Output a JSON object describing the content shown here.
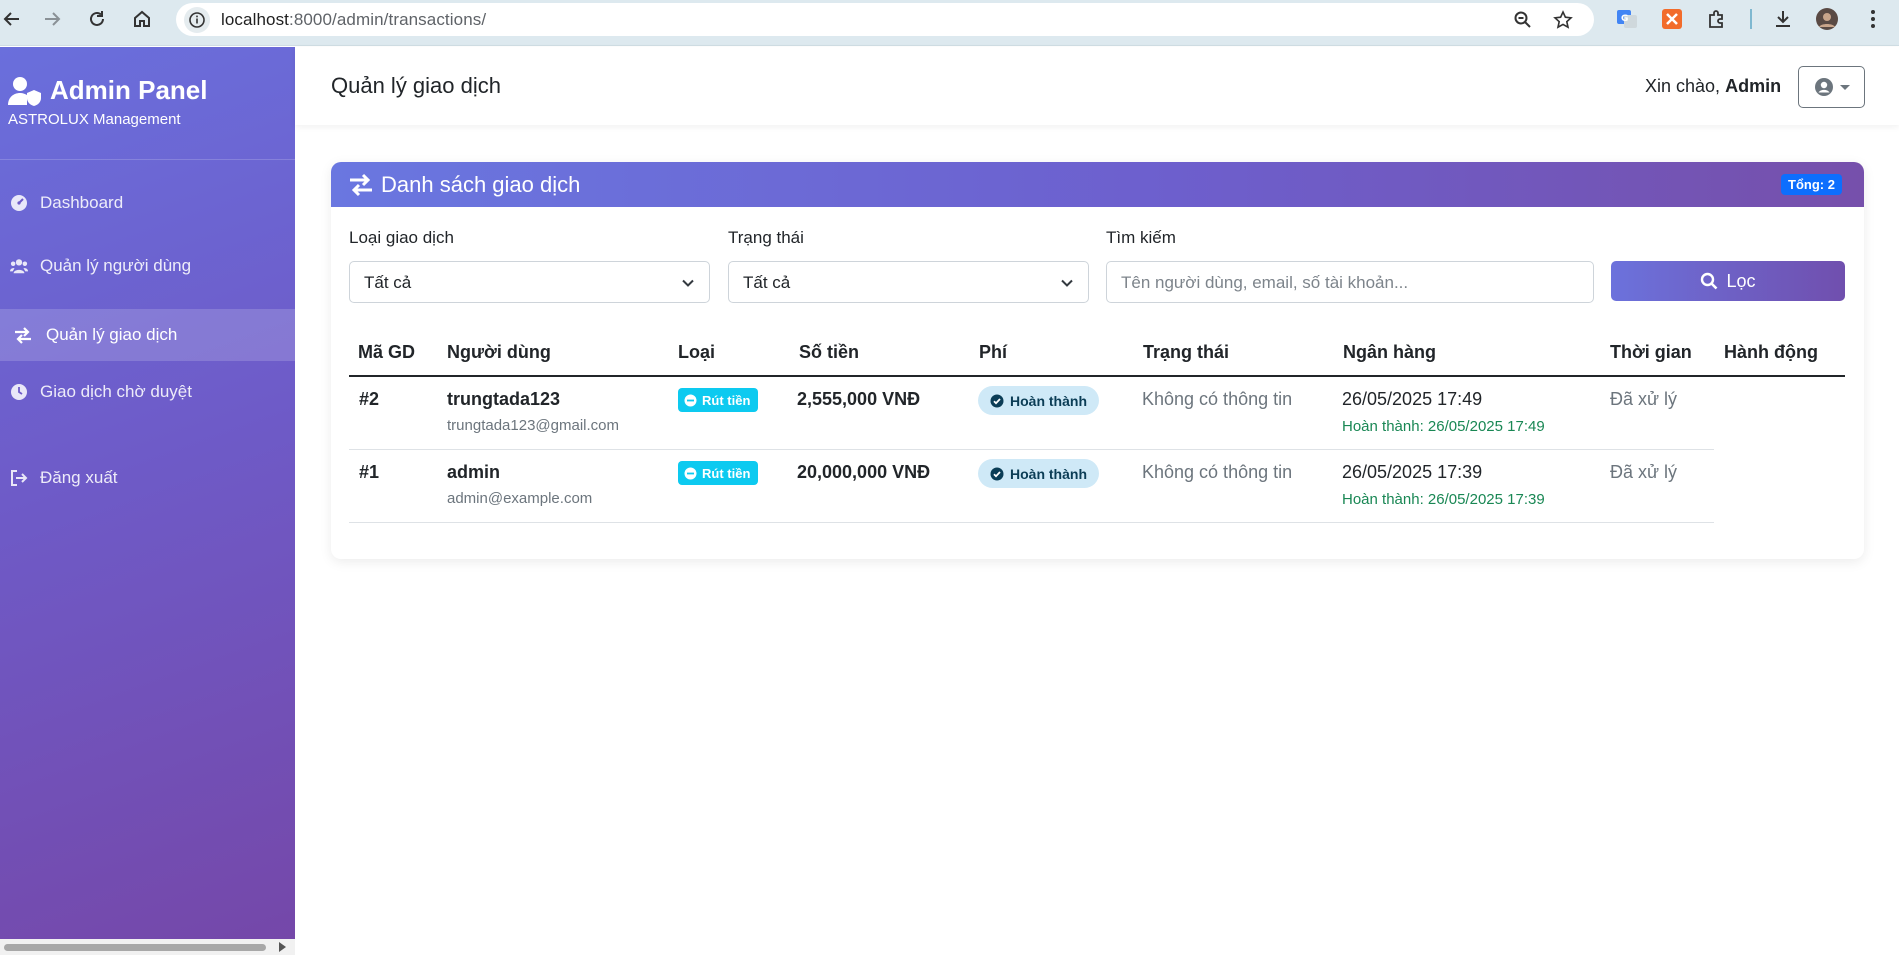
{
  "browser": {
    "url_host": "localhost",
    "url_rest": ":8000/admin/transactions/"
  },
  "sidebar": {
    "brand_title": "Admin Panel",
    "brand_subtitle": "ASTROLUX Management",
    "items": [
      {
        "label": "Dashboard",
        "icon": "tachometer-icon"
      },
      {
        "label": "Quản lý người dùng",
        "icon": "users-icon"
      },
      {
        "label": "Quản lý giao dịch",
        "icon": "exchange-icon",
        "active": true
      },
      {
        "label": "Giao dịch chờ duyệt",
        "icon": "clock-icon"
      },
      {
        "label": "Đăng xuất",
        "icon": "logout-icon"
      }
    ]
  },
  "header": {
    "title": "Quản lý giao dịch",
    "greeting": "Xin chào,",
    "username": "Admin"
  },
  "card": {
    "title": "Danh sách giao dịch",
    "total_badge": "Tổng: 2"
  },
  "filters": {
    "type_label": "Loại giao dịch",
    "type_value": "Tất cả",
    "status_label": "Trạng thái",
    "status_value": "Tất cả",
    "search_label": "Tìm kiếm",
    "search_placeholder": "Tên người dùng, email, số tài khoản...",
    "filter_button": "Lọc"
  },
  "table": {
    "columns": [
      "Mã GD",
      "Người dùng",
      "Loại",
      "Số tiền",
      "Phí",
      "Trạng thái",
      "Ngân hàng",
      "Thời gian",
      "Hành động"
    ],
    "rows": [
      {
        "id": "#2",
        "username": "trungtada123",
        "email": "trungtada123@gmail.com",
        "type": "Rút tiền",
        "amount": "2,555,000 VNĐ",
        "fee_status": "Hoàn thành",
        "status": "Không có thông tin",
        "bank_date": "26/05/2025 17:49",
        "bank_done": "Hoàn thành: 26/05/2025 17:49",
        "time": "Đã xử lý"
      },
      {
        "id": "#1",
        "username": "admin",
        "email": "admin@example.com",
        "type": "Rút tiền",
        "amount": "20,000,000 VNĐ",
        "fee_status": "Hoàn thành",
        "status": "Không có thông tin",
        "bank_date": "26/05/2025 17:39",
        "bank_done": "Hoàn thành: 26/05/2025 17:39",
        "time": "Đã xử lý"
      }
    ]
  },
  "colors": {
    "accent_start": "#6a77e0",
    "accent_end": "#7650ab",
    "badge_info": "#0dcaf0",
    "badge_primary": "#0d6efd",
    "success_text": "#198754"
  }
}
